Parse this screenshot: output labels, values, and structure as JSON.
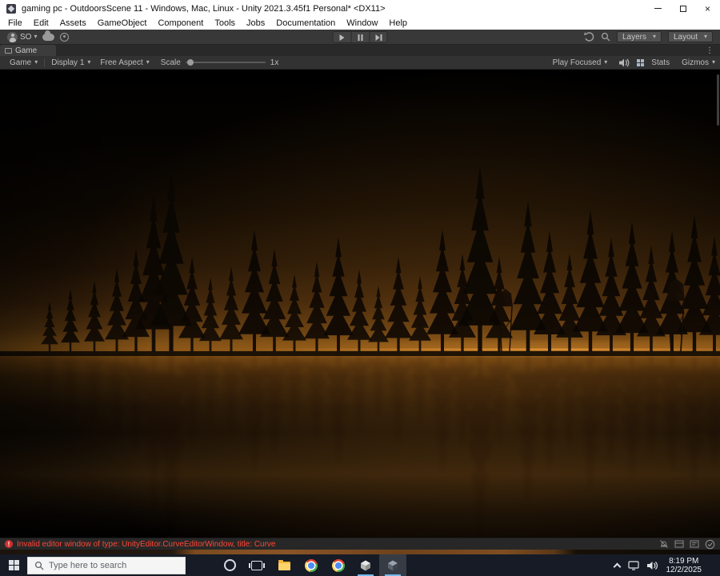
{
  "titlebar": {
    "title": "gaming pc - OutdoorsScene 11 - Windows, Mac, Linux - Unity 2021.3.45f1 Personal* <DX11>",
    "close": "×"
  },
  "menubar": {
    "items": [
      "File",
      "Edit",
      "Assets",
      "GameObject",
      "Component",
      "Tools",
      "Jobs",
      "Documentation",
      "Window",
      "Help"
    ]
  },
  "unity_toolbar": {
    "account_label": "SO",
    "layers_label": "Layers",
    "layout_label": "Layout"
  },
  "tab": {
    "label": "Game"
  },
  "game_toolbar": {
    "view_dropdown": "Game",
    "display_dropdown": "Display 1",
    "aspect_dropdown": "Free Aspect",
    "scale_label": "Scale",
    "scale_value": "1x",
    "play_focused": "Play Focused",
    "stats_label": "Stats",
    "gizmos_label": "Gizmos"
  },
  "status": {
    "error_text": "Invalid editor window of type: UnityEditor.CurveEditorWindow, title: Curve"
  },
  "taskbar": {
    "search_placeholder": "Type here to search",
    "clock_time": "8:19 PM",
    "clock_date": "12/2/2025"
  },
  "icons": {
    "chevron_down": "▾",
    "kebab": "⋮",
    "error_mark": "!"
  },
  "colors": {
    "error_red": "#ff4636",
    "horizon_orange": "#8a5717",
    "taskbar_bg": "#161b26"
  }
}
